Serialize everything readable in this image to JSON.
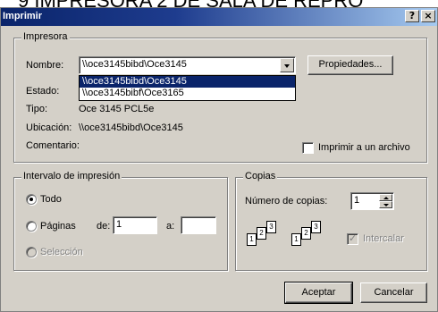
{
  "background_text": "9 IMPRESORA 2 DE SALA DE REPRO",
  "window": {
    "title": "Imprimir",
    "help_glyph": "?",
    "close_glyph": "×"
  },
  "printer": {
    "group_label": "Impresora",
    "name_label": "Nombre:",
    "name_value": "\\\\oce3145bibd\\Oce3145",
    "dropdown_items": [
      "\\\\oce3145bibd\\Oce3145",
      "\\\\oce3145bibf\\Oce3165"
    ],
    "properties_button": "Propiedades...",
    "status_label": "Estado:",
    "type_label": "Tipo:",
    "type_value": "Oce 3145 PCL5e",
    "location_label": "Ubicación:",
    "location_value": "\\\\oce3145bibd\\Oce3145",
    "comment_label": "Comentario:",
    "print_to_file_label": "Imprimir a un archivo"
  },
  "range": {
    "group_label": "Intervalo de impresión",
    "all_label": "Todo",
    "pages_label": "Páginas",
    "from_label": "de:",
    "from_value": "1",
    "to_label": "a:",
    "to_value": "",
    "selection_label": "Selección"
  },
  "copies": {
    "group_label": "Copias",
    "count_label": "Número de copias:",
    "count_value": "1",
    "collate_label": "Intercalar",
    "page_numbers": [
      "1",
      "2",
      "3"
    ]
  },
  "buttons": {
    "ok": "Aceptar",
    "cancel": "Cancelar"
  },
  "colors": {
    "title_bar": "#0a246a",
    "face": "#d4d0c8",
    "selection": "#0a246a"
  }
}
